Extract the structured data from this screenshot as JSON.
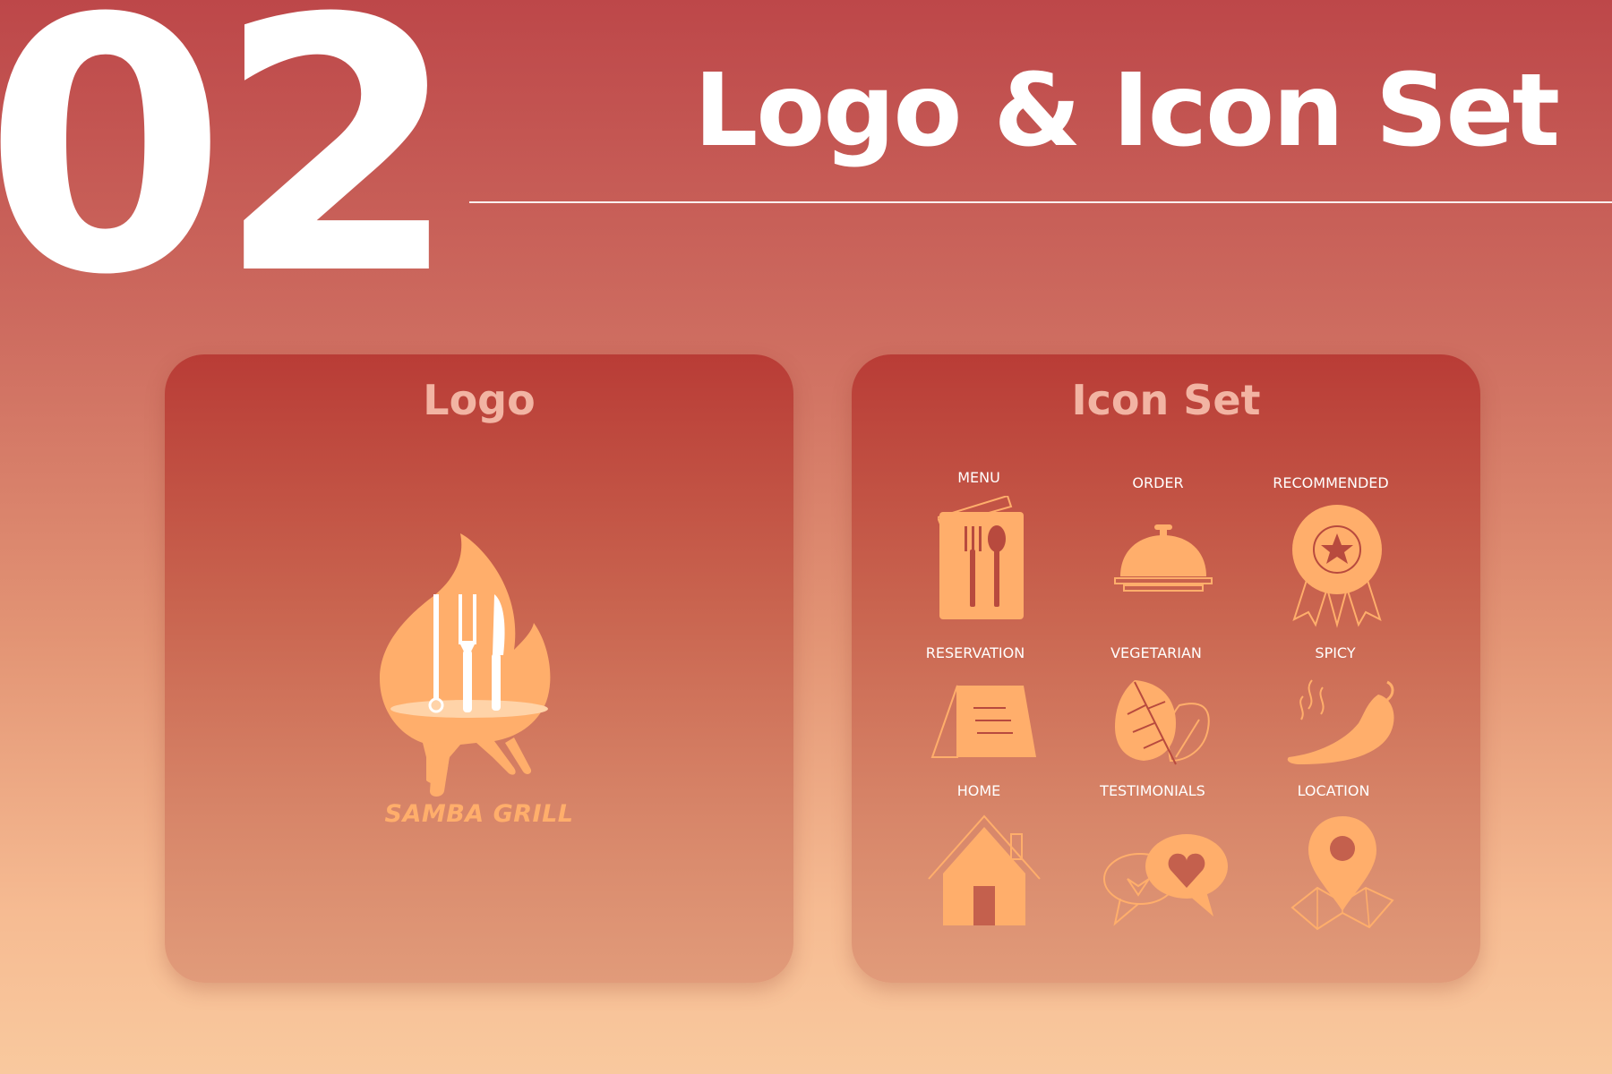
{
  "header": {
    "number": "02",
    "title": "Logo & Icon Set"
  },
  "logo_card": {
    "heading": "Logo",
    "brand_text": "SAMBA GRILL"
  },
  "icon_card": {
    "heading": "Icon Set",
    "icons": [
      {
        "label": "MENU",
        "icon": "menu-icon"
      },
      {
        "label": "ORDER",
        "icon": "service-bell-icon"
      },
      {
        "label": "RECOMMENDED",
        "icon": "award-badge-icon"
      },
      {
        "label": "RESERVATION",
        "icon": "reserved-sign-icon"
      },
      {
        "label": "VEGETARIAN",
        "icon": "leaf-icon"
      },
      {
        "label": "SPICY",
        "icon": "chili-pepper-icon"
      },
      {
        "label": "HOME",
        "icon": "house-icon"
      },
      {
        "label": "TESTIMONIALS",
        "icon": "chat-heart-icon"
      },
      {
        "label": "LOCATION",
        "icon": "map-pin-icon"
      }
    ]
  },
  "colors": {
    "accent": "#ffae6b",
    "title_text": "#ffffff",
    "card_heading": "#f2b4a3"
  }
}
